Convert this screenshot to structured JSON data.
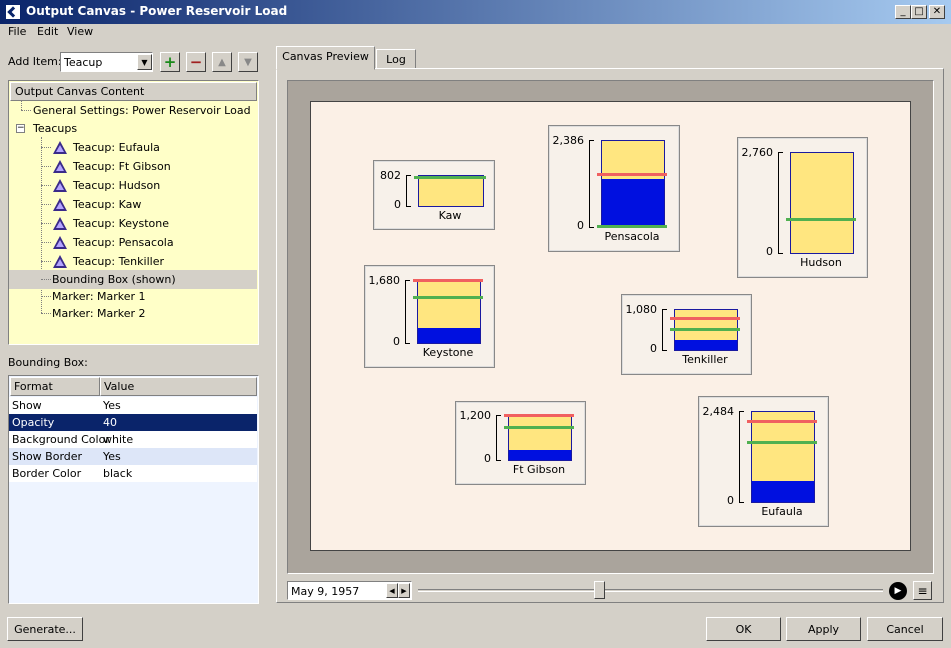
{
  "window": {
    "title": "Output Canvas - Power Reservoir Load",
    "min": "_",
    "max": "□",
    "close": "✕"
  },
  "menu": [
    "File",
    "Edit",
    "View"
  ],
  "add_item": {
    "label": "Add Item:",
    "value": "Teacup",
    "dropdown": "▼",
    "add": "+",
    "remove": "−",
    "up": "▲",
    "down": "▼"
  },
  "tree": {
    "header": "Output Canvas Content",
    "general": "General Settings: Power Reservoir Load",
    "group": "Teacups",
    "teacups": [
      "Teacup: Eufaula",
      "Teacup: Ft Gibson",
      "Teacup: Hudson",
      "Teacup: Kaw",
      "Teacup: Keystone",
      "Teacup: Pensacola",
      "Teacup: Tenkiller"
    ],
    "bounding_box": "Bounding Box (shown)",
    "markers": [
      "Marker: Marker 1",
      "Marker: Marker 2"
    ],
    "expander": "−"
  },
  "bbox": {
    "label": "Bounding Box:",
    "col_format": "Format",
    "col_value": "Value",
    "rows": [
      {
        "format": "Show",
        "value": "Yes"
      },
      {
        "format": "Opacity",
        "value": "40"
      },
      {
        "format": "Background Color",
        "value": "white"
      },
      {
        "format": "Show Border",
        "value": "Yes"
      },
      {
        "format": "Border Color",
        "value": "black"
      }
    ]
  },
  "tabs": [
    "Canvas Preview",
    "Log"
  ],
  "date": {
    "value": "May 9, 1957",
    "left": "◀",
    "right": "▶"
  },
  "playback": {
    "play": "▶",
    "list": "≡",
    "position": 0.39
  },
  "buttons": {
    "generate": "Generate...",
    "ok": "OK",
    "apply": "Apply",
    "cancel": "Cancel"
  },
  "colors": {
    "cup_bg": "#ffe680",
    "fill": "#0010e0",
    "red_line": "#f06060",
    "green_line": "#50b050"
  },
  "teacups": [
    {
      "name": "Kaw",
      "max": "802",
      "zero": "0",
      "fill": 0.0,
      "red": null,
      "green": 0.95
    },
    {
      "name": "Pensacola",
      "max": "2,386",
      "zero": "0",
      "fill": 0.57,
      "red": 0.61,
      "green": 0.0
    },
    {
      "name": "Hudson",
      "max": "2,760",
      "zero": "0",
      "fill": 0.0,
      "red": null,
      "green": 0.33
    },
    {
      "name": "Keystone",
      "max": "1,680",
      "zero": "0",
      "fill": 0.25,
      "red": 1.0,
      "green": 0.72
    },
    {
      "name": "Tenkiller",
      "max": "1,080",
      "zero": "0",
      "fill": 0.27,
      "red": 0.77,
      "green": 0.51
    },
    {
      "name": "Ft Gibson",
      "max": "1,200",
      "zero": "0",
      "fill": 0.23,
      "red": 1.0,
      "green": 0.72
    },
    {
      "name": "Eufaula",
      "max": "2,484",
      "zero": "0",
      "fill": 0.24,
      "red": 0.89,
      "green": 0.66
    }
  ]
}
